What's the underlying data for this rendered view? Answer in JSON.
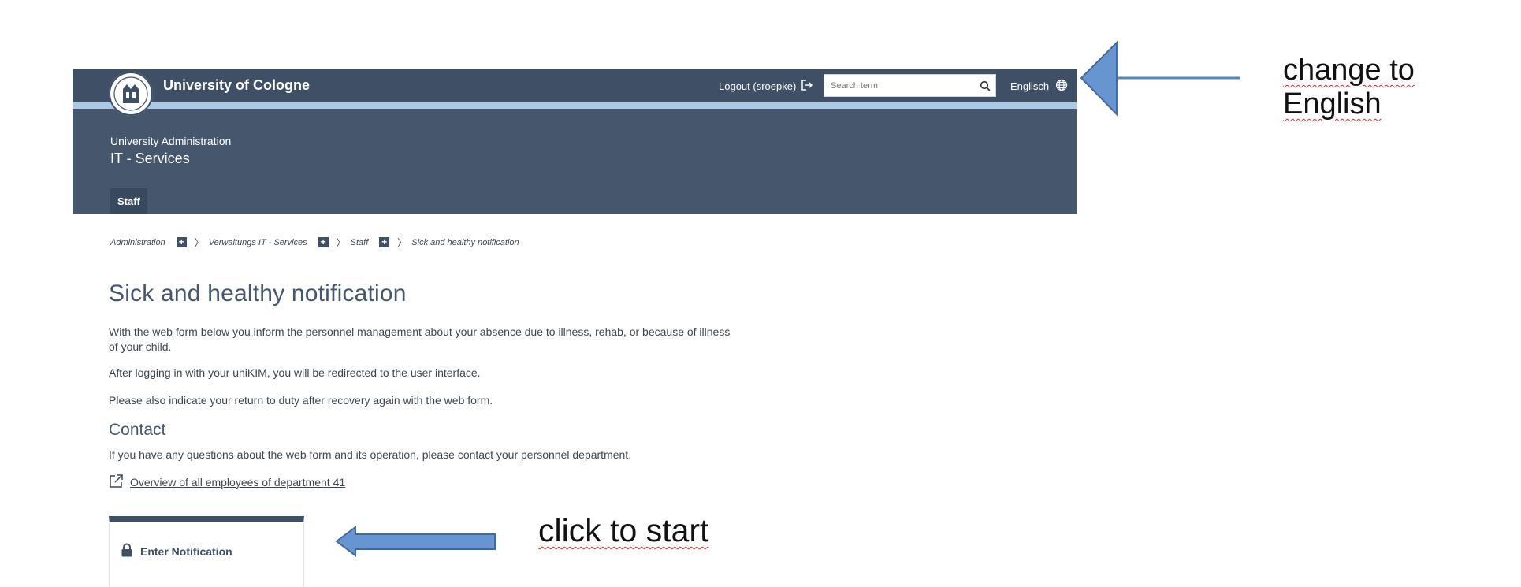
{
  "header": {
    "university_name": "University of Cologne",
    "logout_label": "Logout (sroepke)",
    "search_placeholder": "Search term",
    "language_label": "Englisch",
    "unit_subtitle": "University Administration",
    "unit_title": "IT - Services",
    "nav_items": [
      "Staff"
    ]
  },
  "breadcrumb": [
    "Administration",
    "Verwaltungs IT - Services",
    "Staff",
    "Sick and healthy notification"
  ],
  "main": {
    "title": "Sick and healthy notification",
    "paragraphs": [
      "With the web form below you inform the personnel management about your absence due to illness, rehab, or because of illness of your child.",
      "After logging in with your uniKIM, you will be redirected to the user interface.",
      "Please also indicate your return to duty after recovery again with the web form."
    ],
    "contact_heading": "Contact",
    "contact_text": "If you have any questions about the web form and its operation, please contact your personnel department.",
    "external_link": "Overview of all employees of department 41",
    "notification_button": "Enter Notification"
  },
  "annotations": {
    "language_hint": "change to English",
    "start_hint": "click to start"
  },
  "colors": {
    "topbar": "#3f5066",
    "header": "#46576d",
    "stripe": "#a9cbe8",
    "arrow": "#6695cf"
  }
}
